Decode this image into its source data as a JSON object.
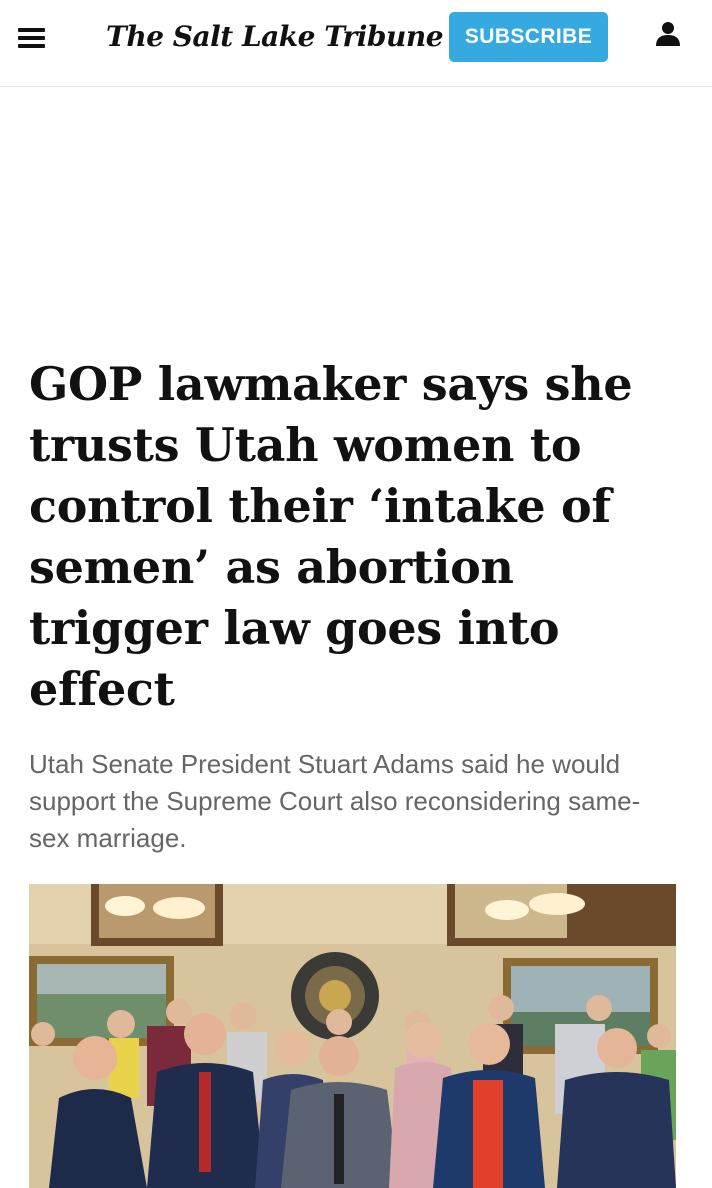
{
  "header": {
    "menu_icon": "hamburger-menu-icon",
    "logo": "The Salt Lake Tribune",
    "subscribe_label": "SUBSCRIBE",
    "account_icon": "person-icon",
    "accent_color": "#36a9e1"
  },
  "article": {
    "headline": "GOP lawmaker says she trusts Utah women to control their ‘intake of semen’ as abortion trigger law goes into effect",
    "dek": "Utah Senate President Stuart Adams said he would support the Supreme Court also reconsidering same-sex marriage.",
    "photo": {
      "seal_text": "UTAH STATE SENATE SEAL"
    }
  }
}
